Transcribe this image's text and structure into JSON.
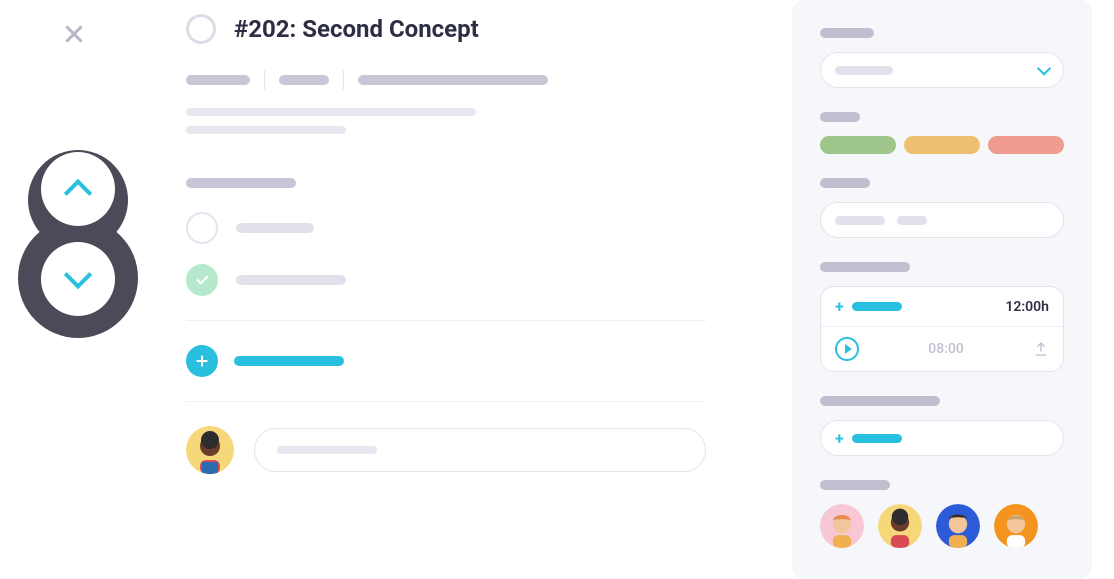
{
  "task": {
    "title": "#202: Second Concept"
  },
  "time_tracking": {
    "total_label": "12:00h",
    "current": "08:00"
  },
  "colors": {
    "accent": "#28c0de",
    "tag_green": "#9ec68b",
    "tag_yellow": "#efbf70",
    "tag_red": "#ef9b90"
  }
}
